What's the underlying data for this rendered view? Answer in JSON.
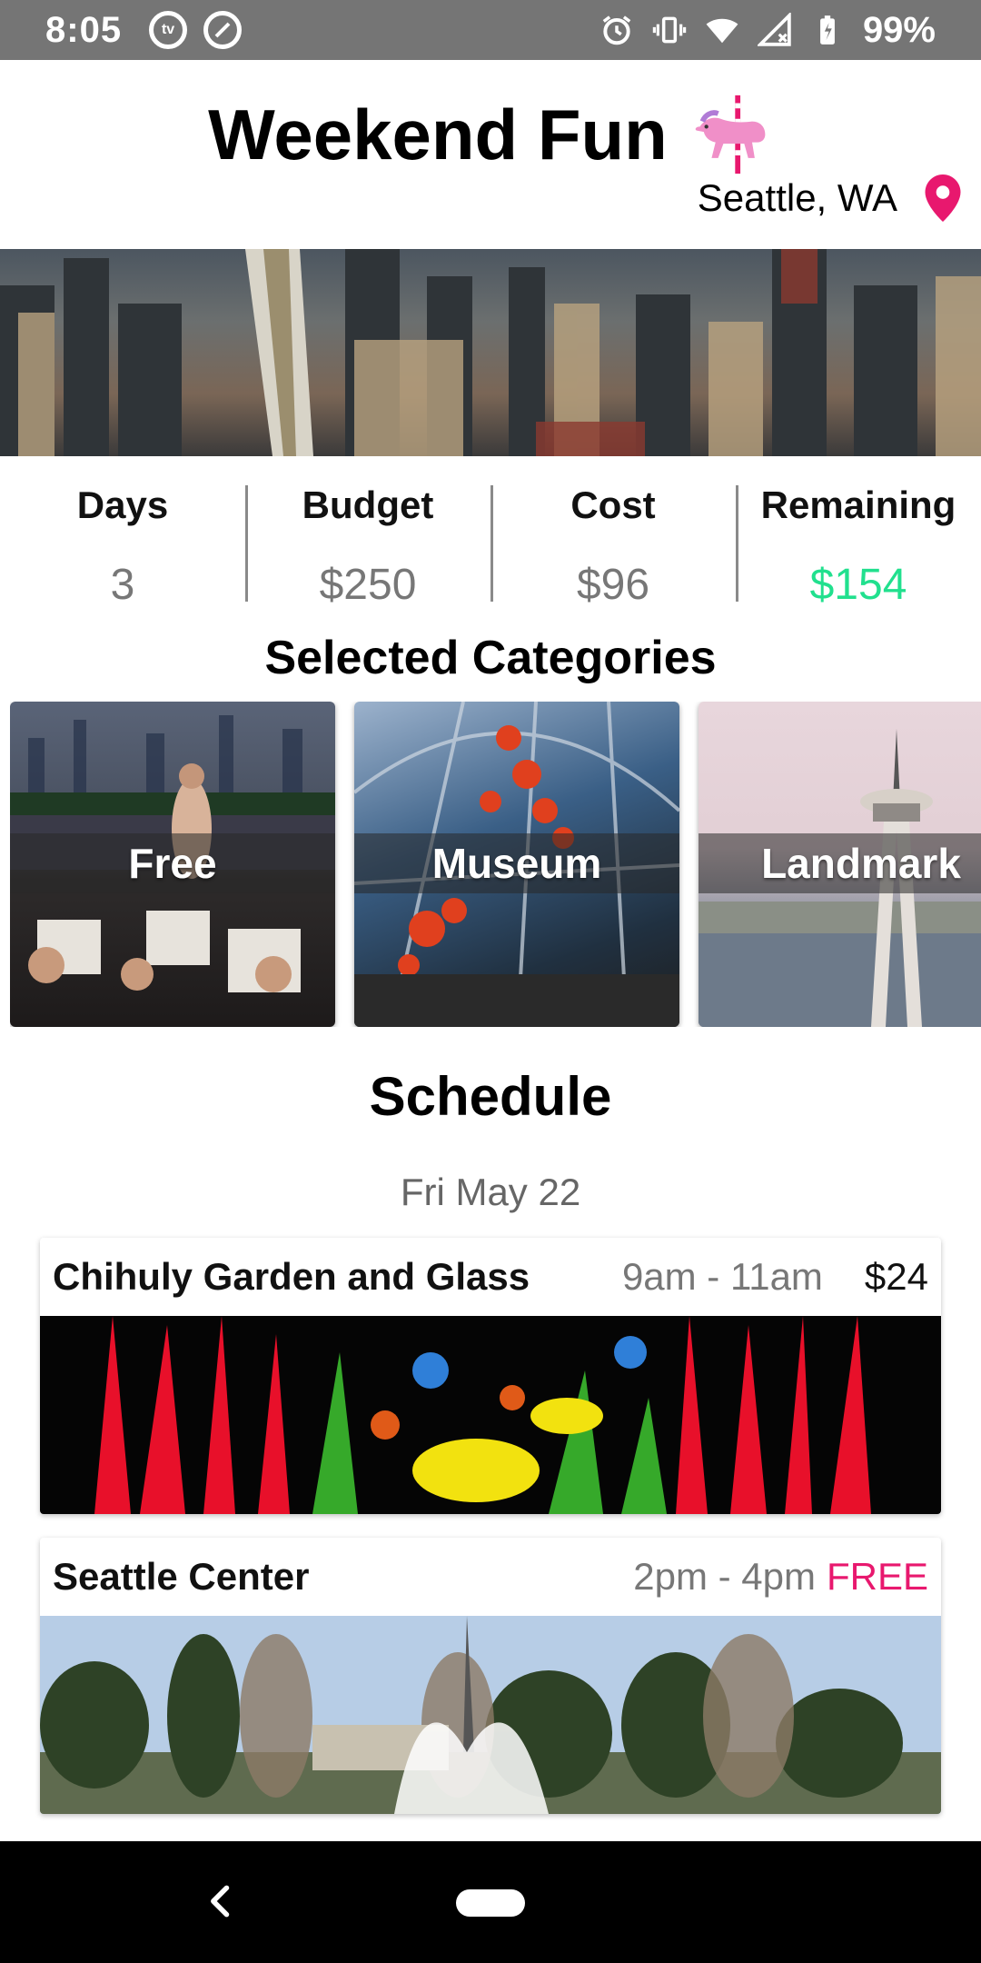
{
  "status_bar": {
    "time": "8:05",
    "battery": "99%",
    "icons": [
      "tv-icon",
      "do-not-disturb-icon",
      "alarm-icon",
      "vibrate-icon",
      "wifi-icon",
      "signal-icon",
      "battery-icon"
    ]
  },
  "header": {
    "title": "Weekend Fun",
    "title_icon": "carousel-horse-icon",
    "location": "Seattle, WA",
    "location_icon": "map-pin-icon",
    "accent_color": "#e8186e"
  },
  "stats": [
    {
      "label": "Days",
      "value": "3"
    },
    {
      "label": "Budget",
      "value": "$250"
    },
    {
      "label": "Cost",
      "value": "$96"
    },
    {
      "label": "Remaining",
      "value": "$154",
      "color": "#21e08e"
    }
  ],
  "categories": {
    "title": "Selected Categories",
    "items": [
      {
        "label": "Free"
      },
      {
        "label": "Museum"
      },
      {
        "label": "Landmark"
      }
    ]
  },
  "schedule": {
    "title": "Schedule",
    "date": "Fri May 22",
    "events": [
      {
        "name": "Chihuly Garden and Glass",
        "time": "9am - 11am",
        "price": "$24"
      },
      {
        "name": "Seattle Center",
        "time": "2pm - 4pm",
        "price": "FREE"
      }
    ]
  },
  "nav": {
    "back_icon": "back-chevron-icon",
    "home_icon": "home-pill-icon"
  }
}
